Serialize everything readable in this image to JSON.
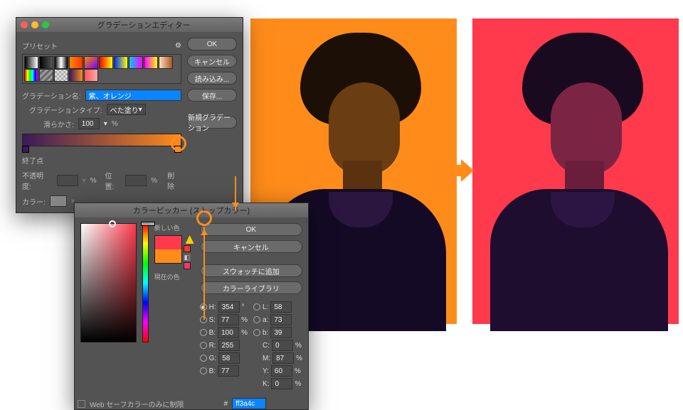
{
  "gradient_editor": {
    "title": "グラデーションエディター",
    "preset_label": "プリセット",
    "buttons": {
      "ok": "OK",
      "cancel": "キャンセル",
      "load": "読み込み...",
      "save": "保存..."
    },
    "name_label": "グラデーション名:",
    "name_value": "紫、オレンジ",
    "new_button": "新規グラデーション",
    "type_label": "グラデーションタイプ:",
    "type_value": "べた塗り",
    "smooth_label": "滑らかさ:",
    "smooth_value": "100",
    "pct": "%",
    "gradient_stops": {
      "left": "#3a1a5a",
      "right": "#ff8c1a"
    },
    "stop_section": "終了点",
    "opacity_label": "不透明度:",
    "position_label": "位置:",
    "delete_label": "削除",
    "color_label": "カラー:",
    "presets": [
      [
        "#000-#fff",
        "#000-#0000",
        "#f00-#0f0",
        "#fa0",
        "#f70-#70f",
        "#f00-#ff0",
        "#00f-#ff0",
        "#0cf-#f0f",
        "#f0f-#ff0",
        "#fdb-#a52"
      ],
      [
        "rainbow",
        "stripes",
        "bw",
        "#fa0",
        "#f55"
      ]
    ]
  },
  "color_picker": {
    "title": "カラーピッカー (ストップカラー)",
    "buttons": {
      "ok": "OK",
      "cancel": "キャンセル",
      "add_swatch": "スウォッチに追加",
      "library": "カラーライブラリ"
    },
    "new_label": "新しい色",
    "current_label": "現在の色",
    "new_color": "#ff3a4c",
    "current_color": "#ff8c1a",
    "hsb": {
      "h": "354",
      "s": "77",
      "b": "100"
    },
    "lab": {
      "l": "58",
      "a": "73",
      "b_": "39"
    },
    "rgb": {
      "r": "255",
      "g": "58",
      "b": "77"
    },
    "cmyk": {
      "c": "0",
      "m": "87",
      "y": "60",
      "k": "0"
    },
    "deg": "°",
    "pct": "%",
    "hex_label": "#",
    "hex_value": "ff3a4c",
    "websafe": "Web セーフカラーのみに制限"
  },
  "icons": {
    "gear": "⚙"
  }
}
